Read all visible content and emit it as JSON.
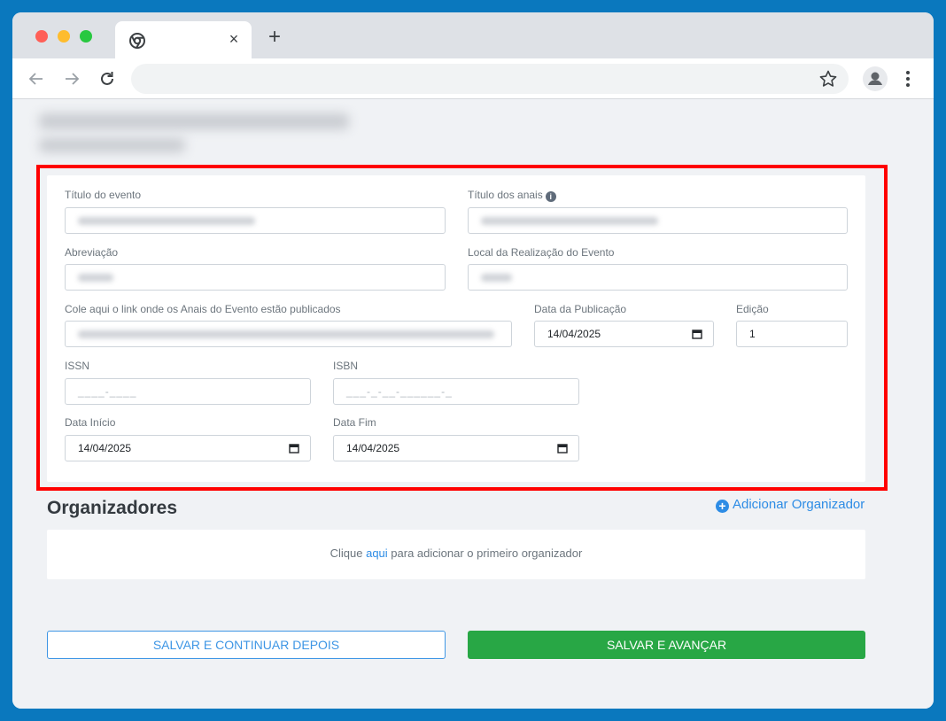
{
  "browser": {
    "tab_close": "×",
    "new_tab": "+"
  },
  "form": {
    "titulo_evento": {
      "label": "Título do evento"
    },
    "titulo_anais": {
      "label": "Título dos anais",
      "info": "i"
    },
    "abreviacao": {
      "label": "Abreviação"
    },
    "local": {
      "label": "Local da Realização do Evento"
    },
    "link_anais": {
      "label": "Cole aqui o link onde os Anais do Evento estão publicados"
    },
    "data_publicacao": {
      "label": "Data da Publicação",
      "value": "14/04/2025"
    },
    "edicao": {
      "label": "Edição",
      "value": "1"
    },
    "issn": {
      "label": "ISSN",
      "placeholder": "____-____"
    },
    "isbn": {
      "label": "ISBN",
      "placeholder": "___-_-__-______-_"
    },
    "data_inicio": {
      "label": "Data Início",
      "value": "14/04/2025"
    },
    "data_fim": {
      "label": "Data Fim",
      "value": "14/04/2025"
    }
  },
  "organizadores": {
    "title": "Organizadores",
    "add_label": "Adicionar Organizador",
    "empty_prefix": "Clique ",
    "empty_link": "aqui",
    "empty_suffix": " para adicionar o primeiro organizador"
  },
  "actions": {
    "save_later": "SALVAR E CONTINUAR DEPOIS",
    "save_next": "SALVAR E AVANÇAR"
  },
  "colors": {
    "highlight": "#ff0000",
    "primary_blue": "#2d8ce5",
    "success_green": "#28a745",
    "background": "#0a78be"
  }
}
